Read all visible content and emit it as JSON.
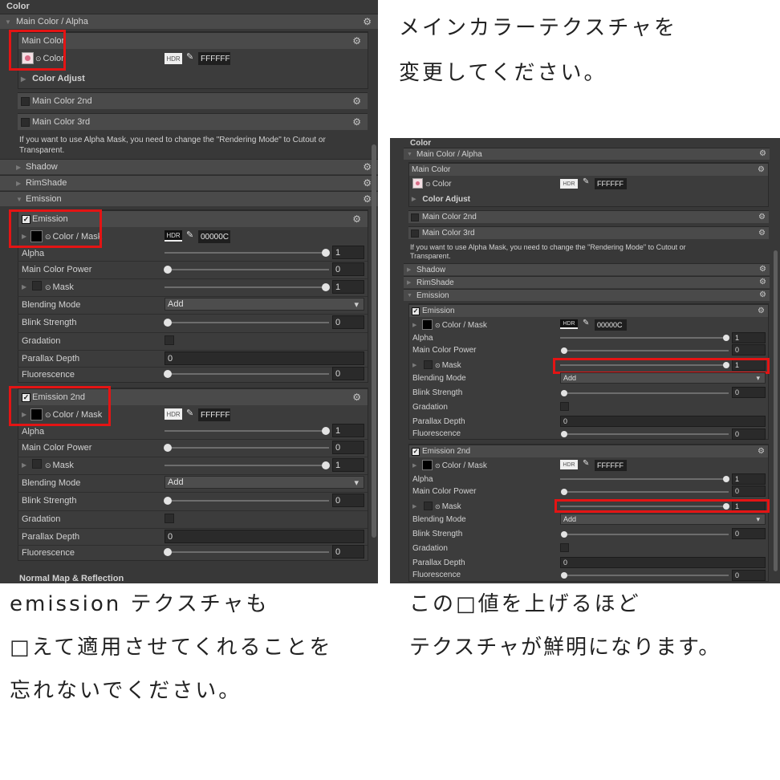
{
  "captions": {
    "top_right_line1": "メインカラーテクスチャを",
    "top_right_line2": "変更してください。",
    "bottom_left_line1": "emission テクスチャも",
    "bottom_left_line2": "□えて適用させてくれることを",
    "bottom_left_line3": "忘れないでください。",
    "bottom_right_line1": "この□値を上げるほど",
    "bottom_right_line2": "テクスチャが鮮明になります。"
  },
  "inspector": {
    "section_title": "Color",
    "main_color_alpha": "Main Color / Alpha",
    "main_color": "Main Color",
    "color_label": "Color",
    "hdr": "HDR",
    "main_hex": "FFFFFF",
    "color_adjust": "Color Adjust",
    "main_color_2nd": "Main Color 2nd",
    "main_color_3rd": "Main Color 3rd",
    "alpha_mask_note_1": "If you want to use Alpha Mask, you need to change the \"Rendering Mode\" to Cutout or",
    "alpha_mask_note_2": "Transparent.",
    "shadow": "Shadow",
    "rimshade": "RimShade",
    "emission_section": "Emission",
    "emission": "Emission",
    "emission_2nd": "Emission 2nd",
    "color_mask": "Color / Mask",
    "emission_hex": "00000C",
    "emission2_hex": "FFFFFF",
    "alpha": "Alpha",
    "main_color_power": "Main Color Power",
    "mask": "Mask",
    "blending_mode": "Blending Mode",
    "blending_value": "Add",
    "blink_strength": "Blink Strength",
    "gradation": "Gradation",
    "parallax_depth": "Parallax Depth",
    "fluorescence": "Fluorescence",
    "normal_map": "Normal Map & Reflection",
    "val_one": "1",
    "val_zero": "0"
  },
  "icons": {
    "gear": "⚙",
    "triangle_right": "▶",
    "triangle_down": "▼",
    "checkmark": "✓",
    "eyedropper": "✎",
    "dropdown_arrow": "▾",
    "circle": "⊙"
  },
  "colors": {
    "panel_bg": "#383838",
    "header_bg": "#4a4a4a",
    "highlight_red": "#e41414"
  }
}
